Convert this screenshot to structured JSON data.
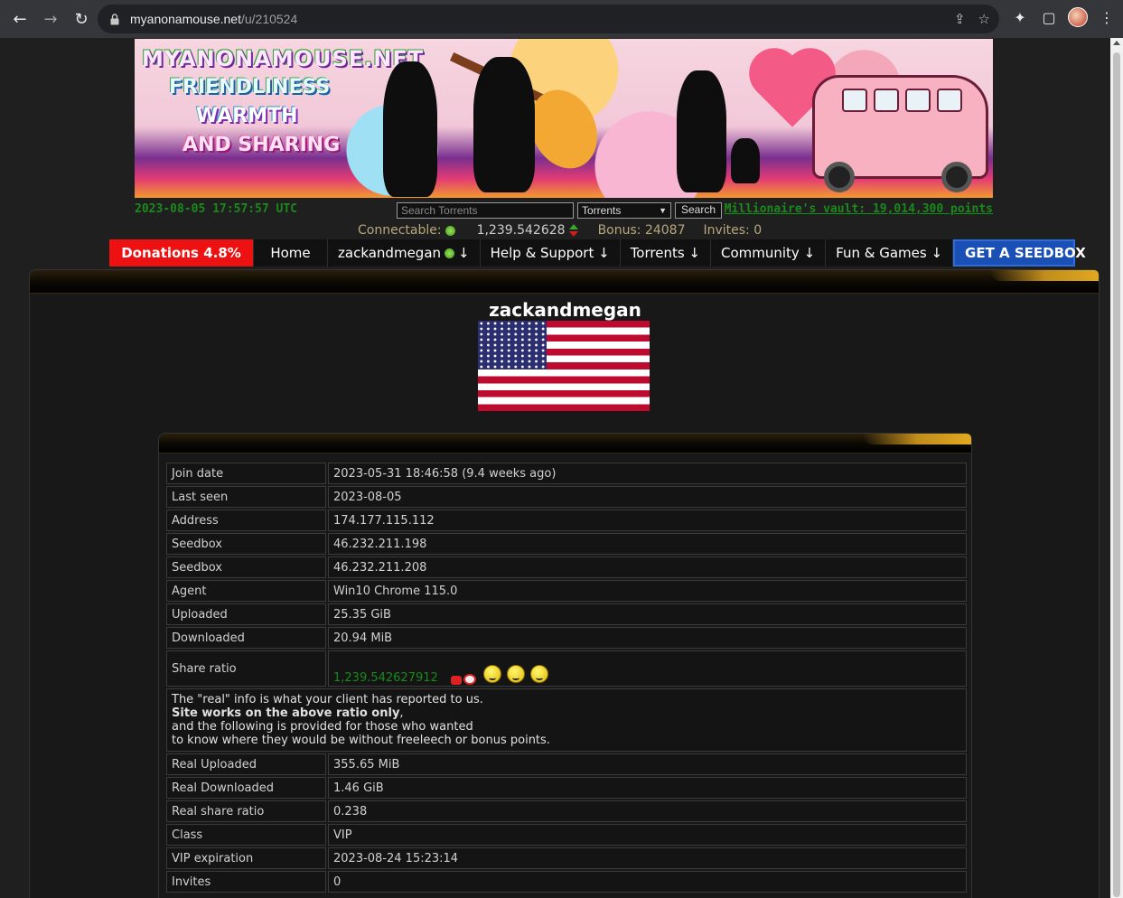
{
  "browser": {
    "url_host": "myanonamouse.net",
    "url_path": "/u/210524"
  },
  "banner": {
    "logo_lines": [
      "MYANONAMOUSE.NET",
      "FRIENDLINESS",
      "WARMTH",
      "AND SHARING"
    ]
  },
  "header": {
    "clock": "2023-08-05 17:57:57 UTC",
    "search_placeholder": "Search Torrents",
    "search_category": "Torrents",
    "search_button": "Search",
    "vault": "Millionaire's vault: 19,014,300 points",
    "connectable_label": "Connectable:",
    "ratio": "1,239.542628",
    "bonus": "Bonus: 24087",
    "invites": "Invites: 0"
  },
  "menu": {
    "donations": "Donations 4.8%",
    "home": "Home",
    "user": "zackandmegan",
    "help": "Help & Support ↓",
    "torrents": "Torrents ↓",
    "community": "Community ↓",
    "fun": "Fun & Games ↓",
    "seedbox": "GET A SEEDBOX",
    "user_arrow": "↓"
  },
  "profile": {
    "username": "zackandmegan",
    "rows": [
      {
        "label": "Join date",
        "value": "2023-05-31 18:46:58 (9.4 weeks ago)"
      },
      {
        "label": "Last seen",
        "value": "2023-08-05"
      },
      {
        "label": "Address",
        "value": "174.177.115.112"
      },
      {
        "label": "Seedbox",
        "value": "46.232.211.198"
      },
      {
        "label": "Seedbox",
        "value": "46.232.211.208"
      },
      {
        "label": "Agent",
        "value": "Win10 Chrome 115.0"
      },
      {
        "label": "Uploaded",
        "value": "25.35 GiB"
      },
      {
        "label": "Downloaded",
        "value": "20.94 MiB"
      }
    ],
    "share_ratio_label": "Share ratio",
    "share_ratio_value": "1,239.542627912",
    "note": {
      "line1": "The \"real\" info is what your client has reported to us.",
      "line2_bold": "Site works on the above ratio only",
      "line2_rest": ",",
      "line3": "and the following is provided for those who wanted",
      "line4": "to know where they would be without freeleech or bonus points."
    },
    "rows2": [
      {
        "label": "Real Uploaded",
        "value": "355.65 MiB"
      },
      {
        "label": "Real Downloaded",
        "value": "1.46 GiB"
      },
      {
        "label": "Real share ratio",
        "value": "0.238"
      },
      {
        "label": "Class",
        "value": "VIP"
      },
      {
        "label": "VIP expiration",
        "value": "2023-08-24 15:23:14"
      },
      {
        "label": "Invites",
        "value": "0"
      }
    ]
  }
}
